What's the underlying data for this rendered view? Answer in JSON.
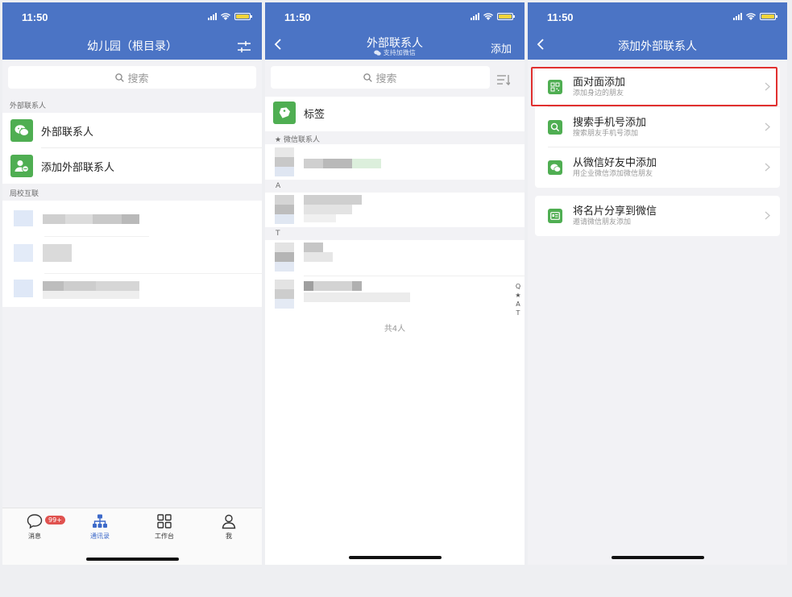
{
  "status": {
    "time": "11:50"
  },
  "screen1": {
    "title": "幼儿园（根目录）",
    "search_placeholder": "搜索",
    "section_external": "外部联系人",
    "items": [
      {
        "label": "外部联系人",
        "icon": "wechat-icon"
      },
      {
        "label": "添加外部联系人",
        "icon": "add-contact-icon"
      }
    ],
    "section_school": "局校互联",
    "tabbar": {
      "tabs": [
        {
          "label": "消息",
          "icon": "chat-icon",
          "badge": "99+"
        },
        {
          "label": "通讯录",
          "icon": "org-chart-icon",
          "active": true
        },
        {
          "label": "工作台",
          "icon": "grid-icon"
        },
        {
          "label": "我",
          "icon": "person-icon"
        }
      ]
    }
  },
  "screen2": {
    "title": "外部联系人",
    "subtitle": "支持加微信",
    "add_label": "添加",
    "search_placeholder": "搜索",
    "tag_label": "标签",
    "section_wechat": "微信联系人",
    "section_a": "A",
    "section_t": "T",
    "index": [
      "Q",
      "★",
      "A",
      "T"
    ],
    "total": "共4人"
  },
  "screen3": {
    "title": "添加外部联系人",
    "options": [
      {
        "title": "面对面添加",
        "subtitle": "添加身边的朋友",
        "icon": "qr-code-icon",
        "highlighted": true
      },
      {
        "title": "搜索手机号添加",
        "subtitle": "搜索朋友手机号添加",
        "icon": "search-icon"
      },
      {
        "title": "从微信好友中添加",
        "subtitle": "用企业微信添加微信朋友",
        "icon": "wechat-icon"
      }
    ],
    "share": {
      "title": "将名片分享到微信",
      "subtitle": "邀请微信朋友添加",
      "icon": "business-card-icon"
    }
  },
  "colors": {
    "header": "#4b74c5",
    "green": "#4fae52",
    "highlight": "#e1302f",
    "active_tab": "#3c69c9",
    "badge": "#e0524f"
  }
}
